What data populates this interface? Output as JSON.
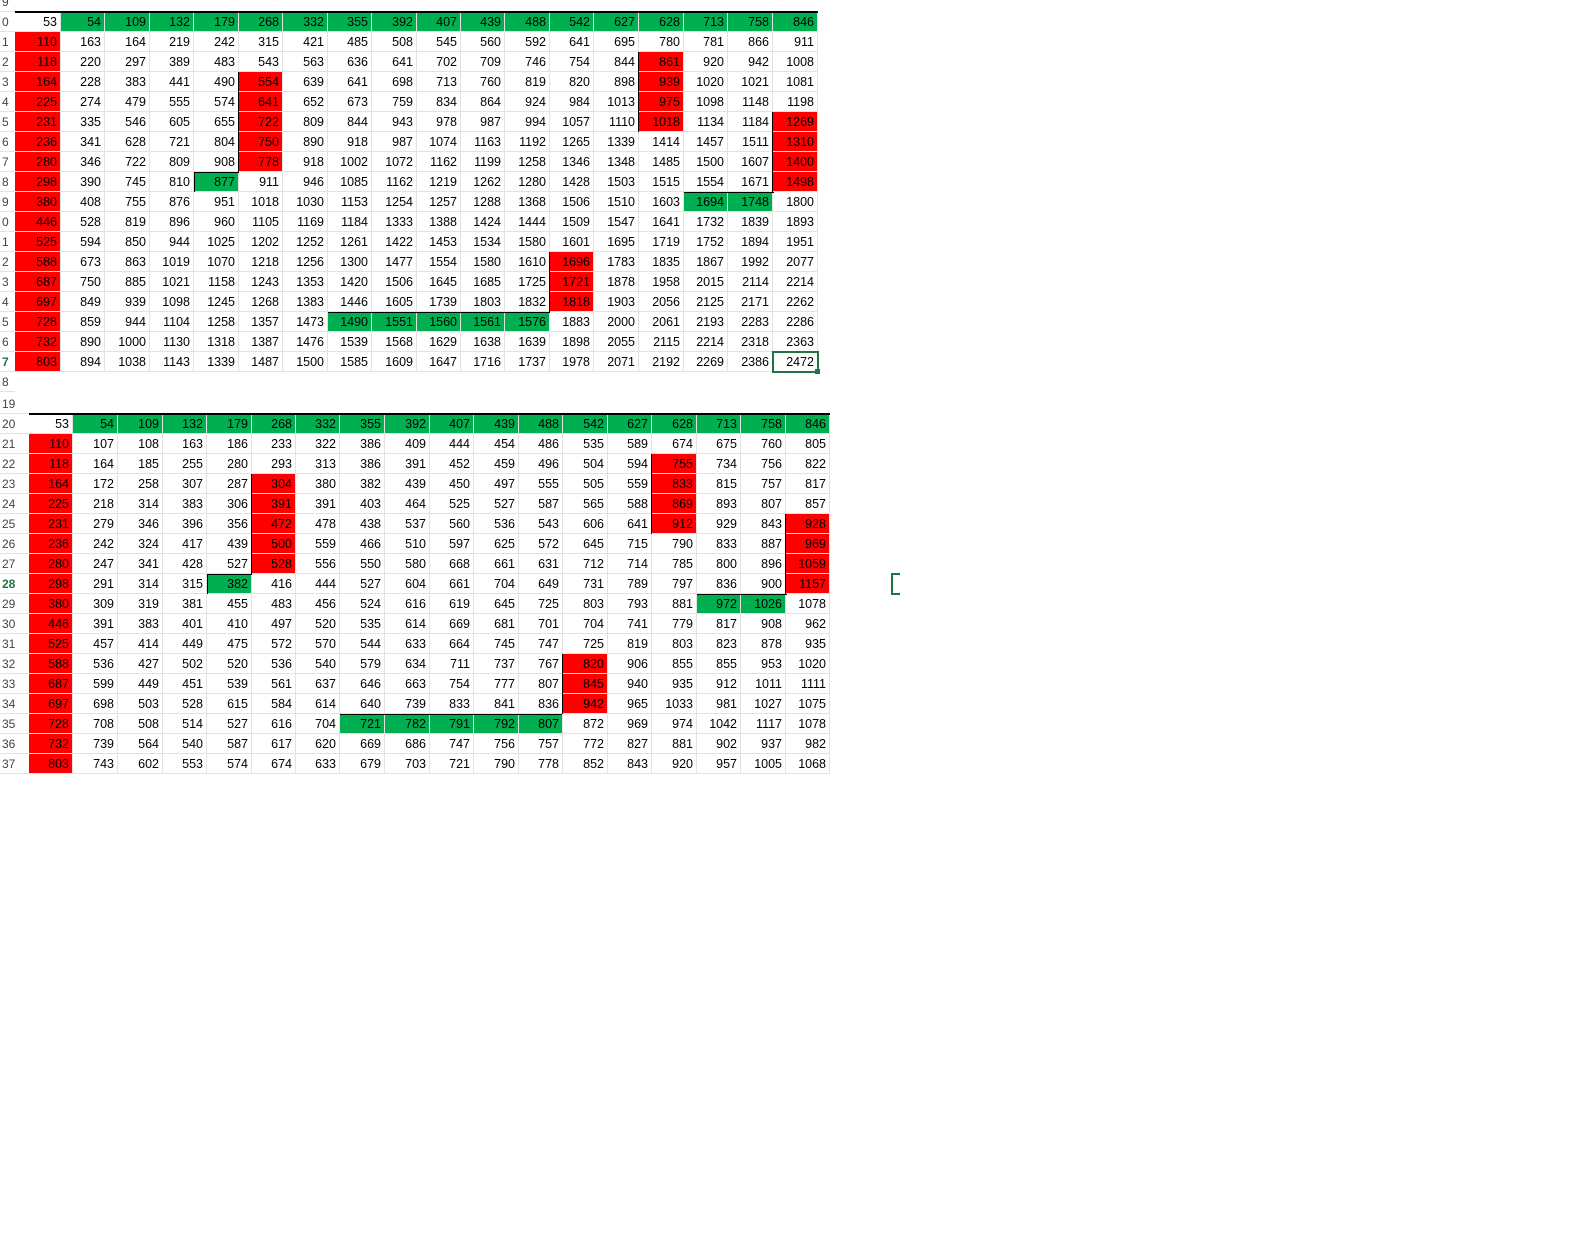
{
  "sheet1": {
    "header_row": {
      "label": "0",
      "values": [
        "53",
        "54",
        "109",
        "132",
        "179",
        "268",
        "332",
        "355",
        "392",
        "407",
        "439",
        "488",
        "542",
        "627",
        "628",
        "713",
        "758",
        "846"
      ]
    },
    "top_row_label": "9",
    "rows": [
      {
        "label": "1",
        "values": [
          "110",
          "163",
          "164",
          "219",
          "242",
          "315",
          "421",
          "485",
          "508",
          "545",
          "560",
          "592",
          "641",
          "695",
          "780",
          "781",
          "866",
          "911"
        ]
      },
      {
        "label": "2",
        "values": [
          "118",
          "220",
          "297",
          "389",
          "483",
          "543",
          "563",
          "636",
          "641",
          "702",
          "709",
          "746",
          "754",
          "844",
          "861",
          "920",
          "942",
          "1008"
        ]
      },
      {
        "label": "3",
        "values": [
          "164",
          "228",
          "383",
          "441",
          "490",
          "554",
          "639",
          "641",
          "698",
          "713",
          "760",
          "819",
          "820",
          "898",
          "939",
          "1020",
          "1021",
          "1081"
        ]
      },
      {
        "label": "4",
        "values": [
          "225",
          "274",
          "479",
          "555",
          "574",
          "641",
          "652",
          "673",
          "759",
          "834",
          "864",
          "924",
          "984",
          "1013",
          "975",
          "1098",
          "1148",
          "1198"
        ]
      },
      {
        "label": "5",
        "values": [
          "231",
          "335",
          "546",
          "605",
          "655",
          "722",
          "809",
          "844",
          "943",
          "978",
          "987",
          "994",
          "1057",
          "1110",
          "1018",
          "1134",
          "1184",
          "1269"
        ]
      },
      {
        "label": "6",
        "values": [
          "236",
          "341",
          "628",
          "721",
          "804",
          "750",
          "890",
          "918",
          "987",
          "1074",
          "1163",
          "1192",
          "1265",
          "1339",
          "1414",
          "1457",
          "1511",
          "1310"
        ]
      },
      {
        "label": "7",
        "values": [
          "280",
          "346",
          "722",
          "809",
          "908",
          "778",
          "918",
          "1002",
          "1072",
          "1162",
          "1199",
          "1258",
          "1346",
          "1348",
          "1485",
          "1500",
          "1607",
          "1400"
        ]
      },
      {
        "label": "8",
        "values": [
          "298",
          "390",
          "745",
          "810",
          "877",
          "911",
          "946",
          "1085",
          "1162",
          "1219",
          "1262",
          "1280",
          "1428",
          "1503",
          "1515",
          "1554",
          "1671",
          "1498"
        ]
      },
      {
        "label": "9",
        "values": [
          "380",
          "408",
          "755",
          "876",
          "951",
          "1018",
          "1030",
          "1153",
          "1254",
          "1257",
          "1288",
          "1368",
          "1506",
          "1510",
          "1603",
          "1694",
          "1748",
          "1800"
        ]
      },
      {
        "label": "0",
        "values": [
          "446",
          "528",
          "819",
          "896",
          "960",
          "1105",
          "1169",
          "1184",
          "1333",
          "1388",
          "1424",
          "1444",
          "1509",
          "1547",
          "1641",
          "1732",
          "1839",
          "1893"
        ]
      },
      {
        "label": "1",
        "values": [
          "525",
          "594",
          "850",
          "944",
          "1025",
          "1202",
          "1252",
          "1261",
          "1422",
          "1453",
          "1534",
          "1580",
          "1601",
          "1695",
          "1719",
          "1752",
          "1894",
          "1951"
        ]
      },
      {
        "label": "2",
        "values": [
          "588",
          "673",
          "863",
          "1019",
          "1070",
          "1218",
          "1256",
          "1300",
          "1477",
          "1554",
          "1580",
          "1610",
          "1696",
          "1783",
          "1835",
          "1867",
          "1992",
          "2077"
        ]
      },
      {
        "label": "3",
        "values": [
          "687",
          "750",
          "885",
          "1021",
          "1158",
          "1243",
          "1353",
          "1420",
          "1506",
          "1645",
          "1685",
          "1725",
          "1721",
          "1878",
          "1958",
          "2015",
          "2114",
          "2214"
        ]
      },
      {
        "label": "4",
        "values": [
          "697",
          "849",
          "939",
          "1098",
          "1245",
          "1268",
          "1383",
          "1446",
          "1605",
          "1739",
          "1803",
          "1832",
          "1818",
          "1903",
          "2056",
          "2125",
          "2171",
          "2262"
        ]
      },
      {
        "label": "5",
        "values": [
          "728",
          "859",
          "944",
          "1104",
          "1258",
          "1357",
          "1473",
          "1490",
          "1551",
          "1560",
          "1561",
          "1576",
          "1883",
          "2000",
          "2061",
          "2193",
          "2283",
          "2286"
        ]
      },
      {
        "label": "6",
        "values": [
          "732",
          "890",
          "1000",
          "1130",
          "1318",
          "1387",
          "1476",
          "1539",
          "1568",
          "1629",
          "1638",
          "1639",
          "1898",
          "2055",
          "2115",
          "2214",
          "2318",
          "2363"
        ]
      },
      {
        "label": "7",
        "values": [
          "803",
          "894",
          "1038",
          "1143",
          "1339",
          "1487",
          "1500",
          "1585",
          "1609",
          "1647",
          "1716",
          "1737",
          "1978",
          "2071",
          "2192",
          "2269",
          "2386",
          "2472"
        ]
      }
    ],
    "bottom_row_label": "8"
  },
  "sheet2": {
    "top_row_label": "19",
    "header_row": {
      "label": "20",
      "values": [
        "53",
        "54",
        "109",
        "132",
        "179",
        "268",
        "332",
        "355",
        "392",
        "407",
        "439",
        "488",
        "542",
        "627",
        "628",
        "713",
        "758",
        "846"
      ]
    },
    "rows": [
      {
        "label": "21",
        "values": [
          "110",
          "107",
          "108",
          "163",
          "186",
          "233",
          "322",
          "386",
          "409",
          "444",
          "454",
          "486",
          "535",
          "589",
          "674",
          "675",
          "760",
          "805"
        ]
      },
      {
        "label": "22",
        "values": [
          "118",
          "164",
          "185",
          "255",
          "280",
          "293",
          "313",
          "386",
          "391",
          "452",
          "459",
          "496",
          "504",
          "594",
          "755",
          "734",
          "756",
          "822"
        ]
      },
      {
        "label": "23",
        "values": [
          "164",
          "172",
          "258",
          "307",
          "287",
          "304",
          "380",
          "382",
          "439",
          "450",
          "497",
          "555",
          "505",
          "559",
          "833",
          "815",
          "757",
          "817"
        ]
      },
      {
        "label": "24",
        "values": [
          "225",
          "218",
          "314",
          "383",
          "306",
          "391",
          "391",
          "403",
          "464",
          "525",
          "527",
          "587",
          "565",
          "588",
          "869",
          "893",
          "807",
          "857"
        ]
      },
      {
        "label": "25",
        "values": [
          "231",
          "279",
          "346",
          "396",
          "356",
          "472",
          "478",
          "438",
          "537",
          "560",
          "536",
          "543",
          "606",
          "641",
          "912",
          "929",
          "843",
          "928"
        ]
      },
      {
        "label": "26",
        "values": [
          "236",
          "242",
          "324",
          "417",
          "439",
          "500",
          "559",
          "466",
          "510",
          "597",
          "625",
          "572",
          "645",
          "715",
          "790",
          "833",
          "887",
          "969"
        ]
      },
      {
        "label": "27",
        "values": [
          "280",
          "247",
          "341",
          "428",
          "527",
          "528",
          "556",
          "550",
          "580",
          "668",
          "661",
          "631",
          "712",
          "714",
          "785",
          "800",
          "896",
          "1059"
        ]
      },
      {
        "label": "28",
        "values": [
          "298",
          "291",
          "314",
          "315",
          "382",
          "416",
          "444",
          "527",
          "604",
          "661",
          "704",
          "649",
          "731",
          "789",
          "797",
          "836",
          "900",
          "1157"
        ]
      },
      {
        "label": "29",
        "values": [
          "380",
          "309",
          "319",
          "381",
          "455",
          "483",
          "456",
          "524",
          "616",
          "619",
          "645",
          "725",
          "803",
          "793",
          "881",
          "972",
          "1026",
          "1078"
        ]
      },
      {
        "label": "30",
        "values": [
          "446",
          "391",
          "383",
          "401",
          "410",
          "497",
          "520",
          "535",
          "614",
          "669",
          "681",
          "701",
          "704",
          "741",
          "779",
          "817",
          "908",
          "962"
        ]
      },
      {
        "label": "31",
        "values": [
          "525",
          "457",
          "414",
          "449",
          "475",
          "572",
          "570",
          "544",
          "633",
          "664",
          "745",
          "747",
          "725",
          "819",
          "803",
          "823",
          "878",
          "935"
        ]
      },
      {
        "label": "32",
        "values": [
          "588",
          "536",
          "427",
          "502",
          "520",
          "536",
          "540",
          "579",
          "634",
          "711",
          "737",
          "767",
          "820",
          "906",
          "855",
          "855",
          "953",
          "1020"
        ]
      },
      {
        "label": "33",
        "values": [
          "687",
          "599",
          "449",
          "451",
          "539",
          "561",
          "637",
          "646",
          "663",
          "754",
          "777",
          "807",
          "845",
          "940",
          "935",
          "912",
          "1011",
          "1111"
        ]
      },
      {
        "label": "34",
        "values": [
          "697",
          "698",
          "503",
          "528",
          "615",
          "584",
          "614",
          "640",
          "739",
          "833",
          "841",
          "836",
          "942",
          "965",
          "1033",
          "981",
          "1027",
          "1075"
        ]
      },
      {
        "label": "35",
        "values": [
          "728",
          "708",
          "508",
          "514",
          "527",
          "616",
          "704",
          "721",
          "782",
          "791",
          "792",
          "807",
          "872",
          "969",
          "974",
          "1042",
          "1117",
          "1078"
        ]
      },
      {
        "label": "36",
        "values": [
          "732",
          "739",
          "564",
          "540",
          "587",
          "617",
          "620",
          "669",
          "686",
          "747",
          "756",
          "757",
          "772",
          "827",
          "881",
          "902",
          "937",
          "982"
        ]
      },
      {
        "label": "37",
        "values": [
          "803",
          "743",
          "602",
          "553",
          "574",
          "674",
          "633",
          "679",
          "703",
          "721",
          "790",
          "778",
          "852",
          "843",
          "920",
          "957",
          "1005",
          "1068"
        ]
      }
    ]
  },
  "colors": {
    "green": "#00b050",
    "red": "#ff0000",
    "selection": "#217346"
  },
  "highlights": {
    "sheet1_red": [
      [
        3,
        5
      ],
      [
        4,
        5
      ],
      [
        5,
        5
      ],
      [
        6,
        5
      ],
      [
        7,
        5
      ],
      [
        2,
        14
      ],
      [
        3,
        14
      ],
      [
        4,
        14
      ],
      [
        5,
        14
      ],
      [
        5,
        17
      ],
      [
        6,
        17
      ],
      [
        7,
        17
      ],
      [
        8,
        17
      ],
      [
        12,
        12
      ],
      [
        13,
        12
      ],
      [
        14,
        12
      ]
    ],
    "sheet1_green": [
      [
        8,
        4
      ],
      [
        9,
        15
      ],
      [
        9,
        16
      ],
      [
        15,
        7
      ],
      [
        15,
        8
      ],
      [
        15,
        9
      ],
      [
        15,
        10
      ],
      [
        15,
        11
      ]
    ],
    "sheet2_red": [
      [
        3,
        5
      ],
      [
        4,
        5
      ],
      [
        5,
        5
      ],
      [
        6,
        5
      ],
      [
        7,
        5
      ],
      [
        2,
        14
      ],
      [
        3,
        14
      ],
      [
        4,
        14
      ],
      [
        5,
        14
      ],
      [
        5,
        17
      ],
      [
        6,
        17
      ],
      [
        7,
        17
      ],
      [
        8,
        17
      ],
      [
        12,
        12
      ],
      [
        13,
        12
      ],
      [
        14,
        12
      ]
    ],
    "sheet2_green": [
      [
        8,
        4
      ],
      [
        9,
        15
      ],
      [
        9,
        16
      ],
      [
        15,
        7
      ],
      [
        15,
        8
      ],
      [
        15,
        9
      ],
      [
        15,
        10
      ],
      [
        15,
        11
      ]
    ]
  },
  "selected_cell": {
    "sheet": "sheet1",
    "value": "2472"
  }
}
